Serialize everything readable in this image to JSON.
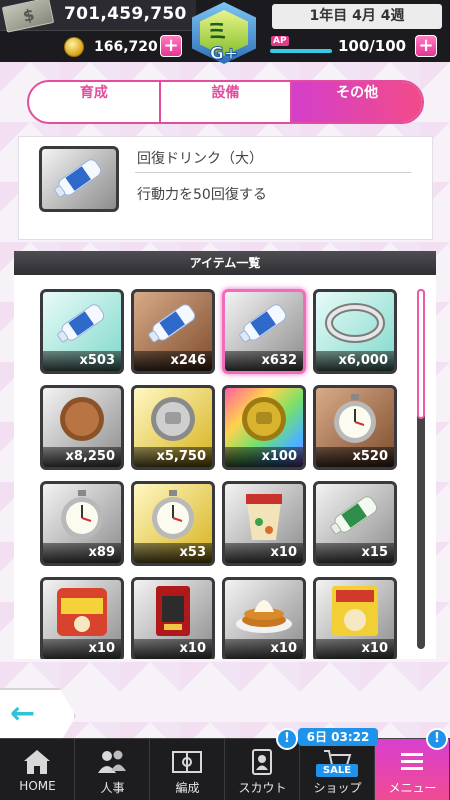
{
  "header": {
    "money": "701,459,750",
    "coins": "166,720",
    "rank": "G+",
    "date": "1年目 4月 4週",
    "ap_label": "AP",
    "ap_value": "100/100",
    "ap_fraction": 1.0,
    "plus_label": "+",
    "emblem_glyph": "ミ"
  },
  "tabs": [
    {
      "label": "育成",
      "active": false
    },
    {
      "label": "設備",
      "active": false
    },
    {
      "label": "その他",
      "active": true
    }
  ],
  "detail": {
    "name": "回復ドリンク（大）",
    "description": "行動力を50回復する"
  },
  "list": {
    "title": "アイテム一覧",
    "items": [
      {
        "icon": "water-bottle-icon",
        "count": "x503",
        "frame": "aqua",
        "selected": false
      },
      {
        "icon": "water-bottle-icon",
        "count": "x246",
        "frame": "bronze",
        "selected": false
      },
      {
        "icon": "water-bottle-icon",
        "count": "x632",
        "frame": "silver",
        "selected": true
      },
      {
        "icon": "ring-icon",
        "count": "x6,000",
        "frame": "aqua",
        "selected": false
      },
      {
        "icon": "bronze-medal-icon",
        "count": "x8,250",
        "frame": "silver",
        "selected": false
      },
      {
        "icon": "silver-medal-icon",
        "count": "x5,750",
        "frame": "gold",
        "selected": false
      },
      {
        "icon": "gold-medal-icon",
        "count": "x100",
        "frame": "rainbow",
        "selected": false
      },
      {
        "icon": "stopwatch-icon",
        "count": "x520",
        "frame": "bronze",
        "selected": false
      },
      {
        "icon": "stopwatch-icon",
        "count": "x89",
        "frame": "silver",
        "selected": false
      },
      {
        "icon": "stopwatch-icon",
        "count": "x53",
        "frame": "gold",
        "selected": false
      },
      {
        "icon": "cup-noodle-icon",
        "count": "x10",
        "frame": "silver",
        "selected": false
      },
      {
        "icon": "green-bottle-icon",
        "count": "x15",
        "frame": "silver",
        "selected": false
      },
      {
        "icon": "instant-noodle-icon",
        "count": "x10",
        "frame": "silver",
        "selected": false
      },
      {
        "icon": "snack-pack-icon",
        "count": "x10",
        "frame": "silver",
        "selected": false
      },
      {
        "icon": "pancake-icon",
        "count": "x10",
        "frame": "silver",
        "selected": false
      },
      {
        "icon": "ramen-pack-icon",
        "count": "x10",
        "frame": "silver",
        "selected": false
      }
    ],
    "scroll_fraction": 0.0
  },
  "nav": [
    {
      "label": "HOME",
      "icon": "house-icon"
    },
    {
      "label": "人事",
      "icon": "people-icon"
    },
    {
      "label": "編成",
      "icon": "field-icon"
    },
    {
      "label": "スカウト",
      "icon": "scout-icon",
      "badge": "!"
    },
    {
      "label": "ショップ",
      "icon": "cart-icon",
      "sale": "SALE",
      "timer": "6日 03:22"
    },
    {
      "label": "メニュー",
      "icon": "menu-icon",
      "badge": "!",
      "active": true
    }
  ],
  "back": {
    "icon": "back-arrow-icon",
    "glyph": "←"
  },
  "colors": {
    "accent_pink": "#e24d9e",
    "badge_blue": "#1f92ea",
    "ap_cyan": "#38c9e6"
  }
}
